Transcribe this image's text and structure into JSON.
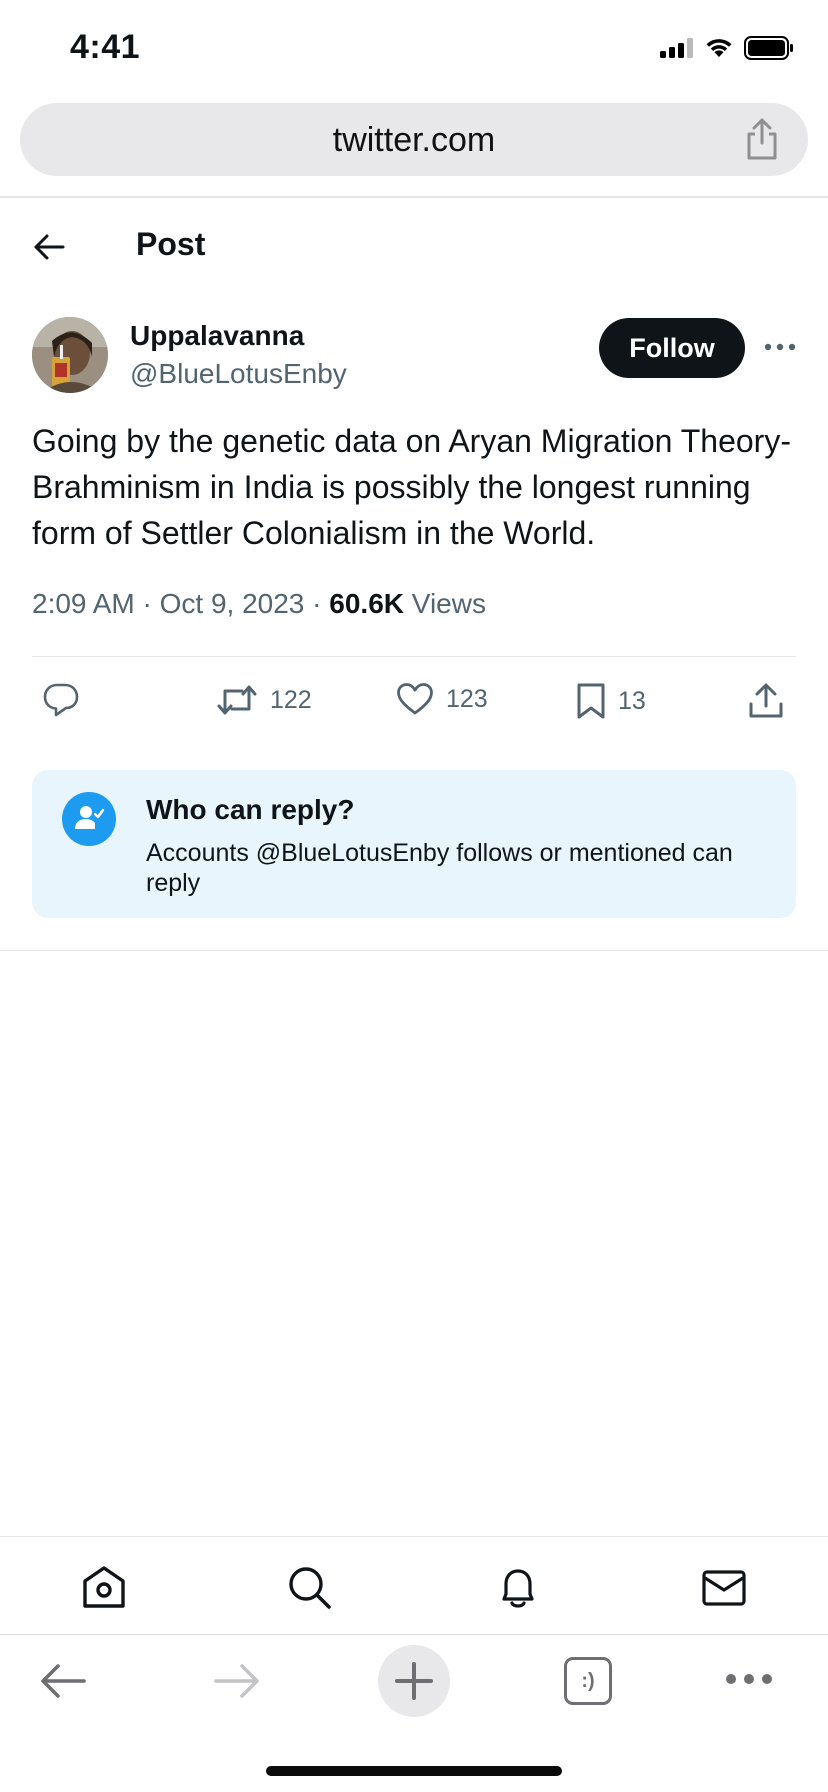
{
  "status_bar": {
    "time": "4:41"
  },
  "browser": {
    "url": "twitter.com"
  },
  "header": {
    "title": "Post"
  },
  "tweet": {
    "display_name": "Uppalavanna",
    "handle": "@BlueLotusEnby",
    "follow_label": "Follow",
    "text": "Going by the genetic data on Aryan Migration Theory-Brahminism in India is possibly the longest running form of Settler Colonialism in the World.",
    "time": "2:09 AM",
    "date": "Oct 9, 2023",
    "separator": "·",
    "views_count": "60.6K",
    "views_label": "Views"
  },
  "actions": {
    "retweets": "122",
    "likes": "123",
    "bookmarks": "13"
  },
  "reply_settings": {
    "title": "Who can reply?",
    "description": "Accounts @BlueLotusEnby follows or mentioned can reply"
  },
  "colors": {
    "accent": "#1d9bf0",
    "text_primary": "#0f1419",
    "text_secondary": "#536471",
    "reply_box_bg": "#e8f5fd"
  },
  "icons": {
    "tabs": [
      "home-icon",
      "search-icon",
      "bell-icon",
      "mail-icon"
    ],
    "browser": [
      "back-icon",
      "forward-icon",
      "plus-icon",
      "tabs-icon",
      "more-icon"
    ]
  },
  "browser_tabs_label": ":)"
}
